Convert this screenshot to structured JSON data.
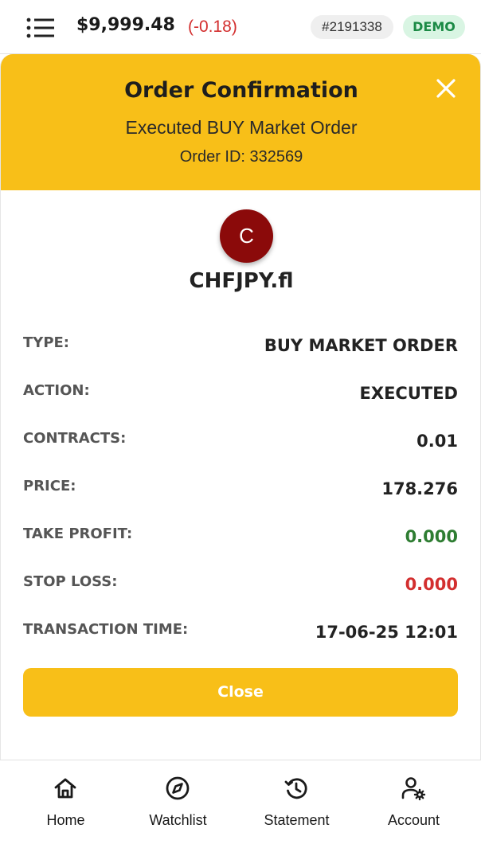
{
  "header": {
    "balance": "$9,999.48",
    "change": "(-0.18)",
    "account_id": "#2191338",
    "mode": "DEMO"
  },
  "modal": {
    "title": "Order Confirmation",
    "subtitle": "Executed BUY Market Order",
    "order_id": "Order ID: 332569",
    "avatar_letter": "C",
    "symbol": "CHFJPY.fl",
    "details": [
      {
        "label": "TYPE:",
        "value": "BUY MARKET ORDER"
      },
      {
        "label": "ACTION:",
        "value": "EXECUTED"
      },
      {
        "label": "CONTRACTS:",
        "value": "0.01"
      },
      {
        "label": "PRICE:",
        "value": "178.276"
      },
      {
        "label": "TAKE PROFIT:",
        "value": "0.000"
      },
      {
        "label": "STOP LOSS:",
        "value": "0.000"
      },
      {
        "label": "TRANSACTION TIME:",
        "value": "17-06-25 12:01"
      }
    ],
    "close_label": "Close"
  },
  "nav": {
    "items": [
      {
        "label": "Home",
        "icon": "home-icon"
      },
      {
        "label": "Watchlist",
        "icon": "compass-icon"
      },
      {
        "label": "Statement",
        "icon": "history-icon"
      },
      {
        "label": "Account",
        "icon": "user-settings-icon"
      }
    ]
  },
  "colors": {
    "accent": "#f8bf18",
    "negative": "#d32f2f",
    "positive": "#2e7d32",
    "avatar": "#8b0a0a",
    "demo_badge_bg": "#d9f5e3",
    "demo_badge_text": "#1b8a45"
  }
}
